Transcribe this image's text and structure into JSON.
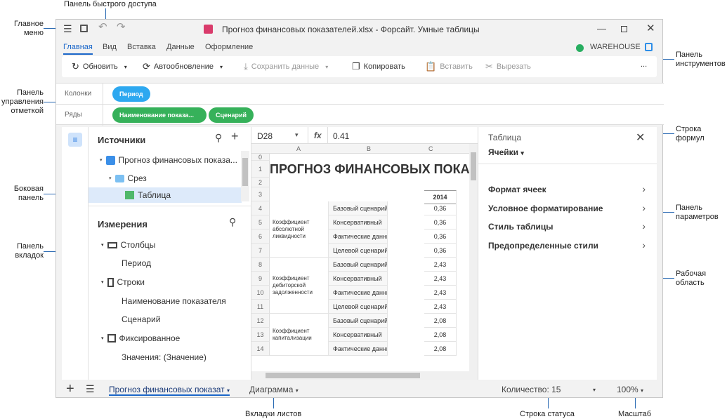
{
  "annotations": {
    "quick_access": "Панель быстрого доступа",
    "main_menu_1": "Главное",
    "main_menu_2": "меню",
    "toolbar_1": "Панель",
    "toolbar_2": "инструментов",
    "mark_1": "Панель",
    "mark_2": "управления",
    "mark_3": "отметкой",
    "side_1": "Боковая",
    "side_2": "панель",
    "tabs_1": "Панель",
    "tabs_2": "вкладок",
    "formula_1": "Строка",
    "formula_2": "формул",
    "params_1": "Панель",
    "params_2": "параметров",
    "work_1": "Рабочая",
    "work_2": "область",
    "sheets": "Вкладки листов",
    "status": "Строка статуса",
    "zoom": "Масштаб"
  },
  "window": {
    "title": "Прогноз финансовых показателей.xlsx - Форсайт. Умные таблицы"
  },
  "menu": {
    "tabs": [
      "Главная",
      "Вид",
      "Вставка",
      "Данные",
      "Оформление"
    ],
    "repository": "WAREHOUSE"
  },
  "toolbar": {
    "refresh": "Обновить",
    "autorefresh": "Автообновление",
    "save_data": "Сохранить данные",
    "copy": "Копировать",
    "paste": "Вставить",
    "cut": "Вырезать",
    "more": "..."
  },
  "mark_panel": {
    "columns_label": "Колонки",
    "rows_label": "Ряды",
    "columns": [
      "Период"
    ],
    "rows": [
      "Наименование показа...",
      "Сценарий"
    ]
  },
  "sidebar": {
    "sources_title": "Источники",
    "sources": [
      "Прогноз финансовых показа...",
      "Срез",
      "Таблица"
    ],
    "dims_title": "Измерения",
    "dims": {
      "columns": "Столбцы",
      "period": "Период",
      "rows": "Строки",
      "indicator": "Наименование показателя",
      "scenario": "Сценарий",
      "fixed": "Фиксированное",
      "values": "Значения: (Значение)"
    }
  },
  "formula": {
    "cell_ref": "D28",
    "fx": "fx",
    "value": "0.41"
  },
  "sheet": {
    "col_headers": [
      "A",
      "B",
      "C"
    ],
    "title": "ПРОГНОЗ ФИНАНСОВЫХ ПОКАЗАТЕЛЕЙ",
    "year": "2014",
    "groups": [
      {
        "name": "Коэффициент абсолютной ликвидности",
        "values": [
          "0,36",
          "0,36",
          "0,36",
          "0,36"
        ]
      },
      {
        "name": "Коэффициент дебиторской задолженности",
        "values": [
          "2,43",
          "2,43",
          "2,43",
          "2,43"
        ]
      },
      {
        "name": "Коэффициент капитализации",
        "values": [
          "2,08",
          "2,08",
          "2,08"
        ]
      }
    ],
    "scenarios": [
      "Базовый сценарий",
      "Консервативный",
      "Фактические данные",
      "Целевой сценарий"
    ],
    "row_numbers": [
      "0",
      "1",
      "2",
      "3",
      "4",
      "5",
      "6",
      "7",
      "8",
      "9",
      "10",
      "11",
      "12",
      "13",
      "14"
    ]
  },
  "params": {
    "context": "Таблица",
    "section": "Ячейки",
    "items": [
      "Формат ячеек",
      "Условное форматирование",
      "Стиль таблицы",
      "Предопределенные стили"
    ]
  },
  "status": {
    "sheet_tab": "Прогноз финансовых показат",
    "chart_tab": "Диаграмма",
    "count": "Количество: 15",
    "zoom": "100%"
  },
  "colors": {
    "accent": "#2da8f0",
    "green_pill": "#36b15a",
    "repo_dot": "#27ae60",
    "annotation": "#1a66c9"
  }
}
